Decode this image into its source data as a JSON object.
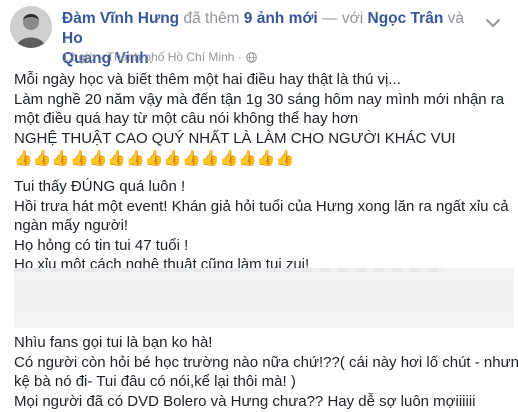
{
  "header": {
    "author": "Đàm Vĩnh Hưng",
    "action_text": "đã thêm",
    "photos_text": "9 ảnh mới",
    "with_text": "— với",
    "tagged_1": "Ngọc Trân",
    "and_text": "và",
    "tagged_2_line1": "Ho",
    "tagged_2_line2": "Quang Vinh",
    "period": ".",
    "time": "12 giờ",
    "location": "· Thành phố Hồ Chí Minh ·"
  },
  "post": {
    "lines_top": [
      "Mỗi ngày học và biết thêm một hai điều hay thật là thú vị...",
      "Làm nghề 20 năm vậy mà đến tận 1g 30 sáng hôm nay mình mới nhận ra",
      "một điều quá hay từ một câu nói không thể hay hơn",
      "NGHỆ THUẬT CAO QUÝ NHẤT LÀ LÀM CHO NGƯỜI KHÁC VUI"
    ],
    "thumbs": "👍👍👍👍👍👍👍👍👍👍👍👍👍👍👍",
    "lines_middle": [
      "Tui thấy ĐÚNG quá luôn !",
      "Hồi trưa hát một event! Khán giả hỏi tuổi của Hưng xong lăn ra ngất xỉu cả",
      "ngàn mấy người!",
      "Họ hỏng có tin tui 47 tuổi !",
      "Họ xỉu một cách nghệ thuật cũng làm tui zui!"
    ],
    "lines_bottom": [
      "Nhìu fans gọi tui là bạn ko hà!",
      "Có người còn hỏi bé học trường nào nữa chứ!??( cái này hơi lố chút - nhưng",
      "kệ bà nó đi- Tui đâu có nói,kể lại thôi mà! )",
      "Mọi người đã có DVD Bolero và Hưng chưa?? Hay dễ sợ luôn mợiiiiii"
    ]
  },
  "colors": {
    "link": "#365899",
    "muted": "#90949c",
    "text": "#1d2129"
  },
  "icons": {
    "globe": "globe-icon",
    "menu": "chevron-down-icon",
    "thumb": "thumbs-up-emoji"
  }
}
